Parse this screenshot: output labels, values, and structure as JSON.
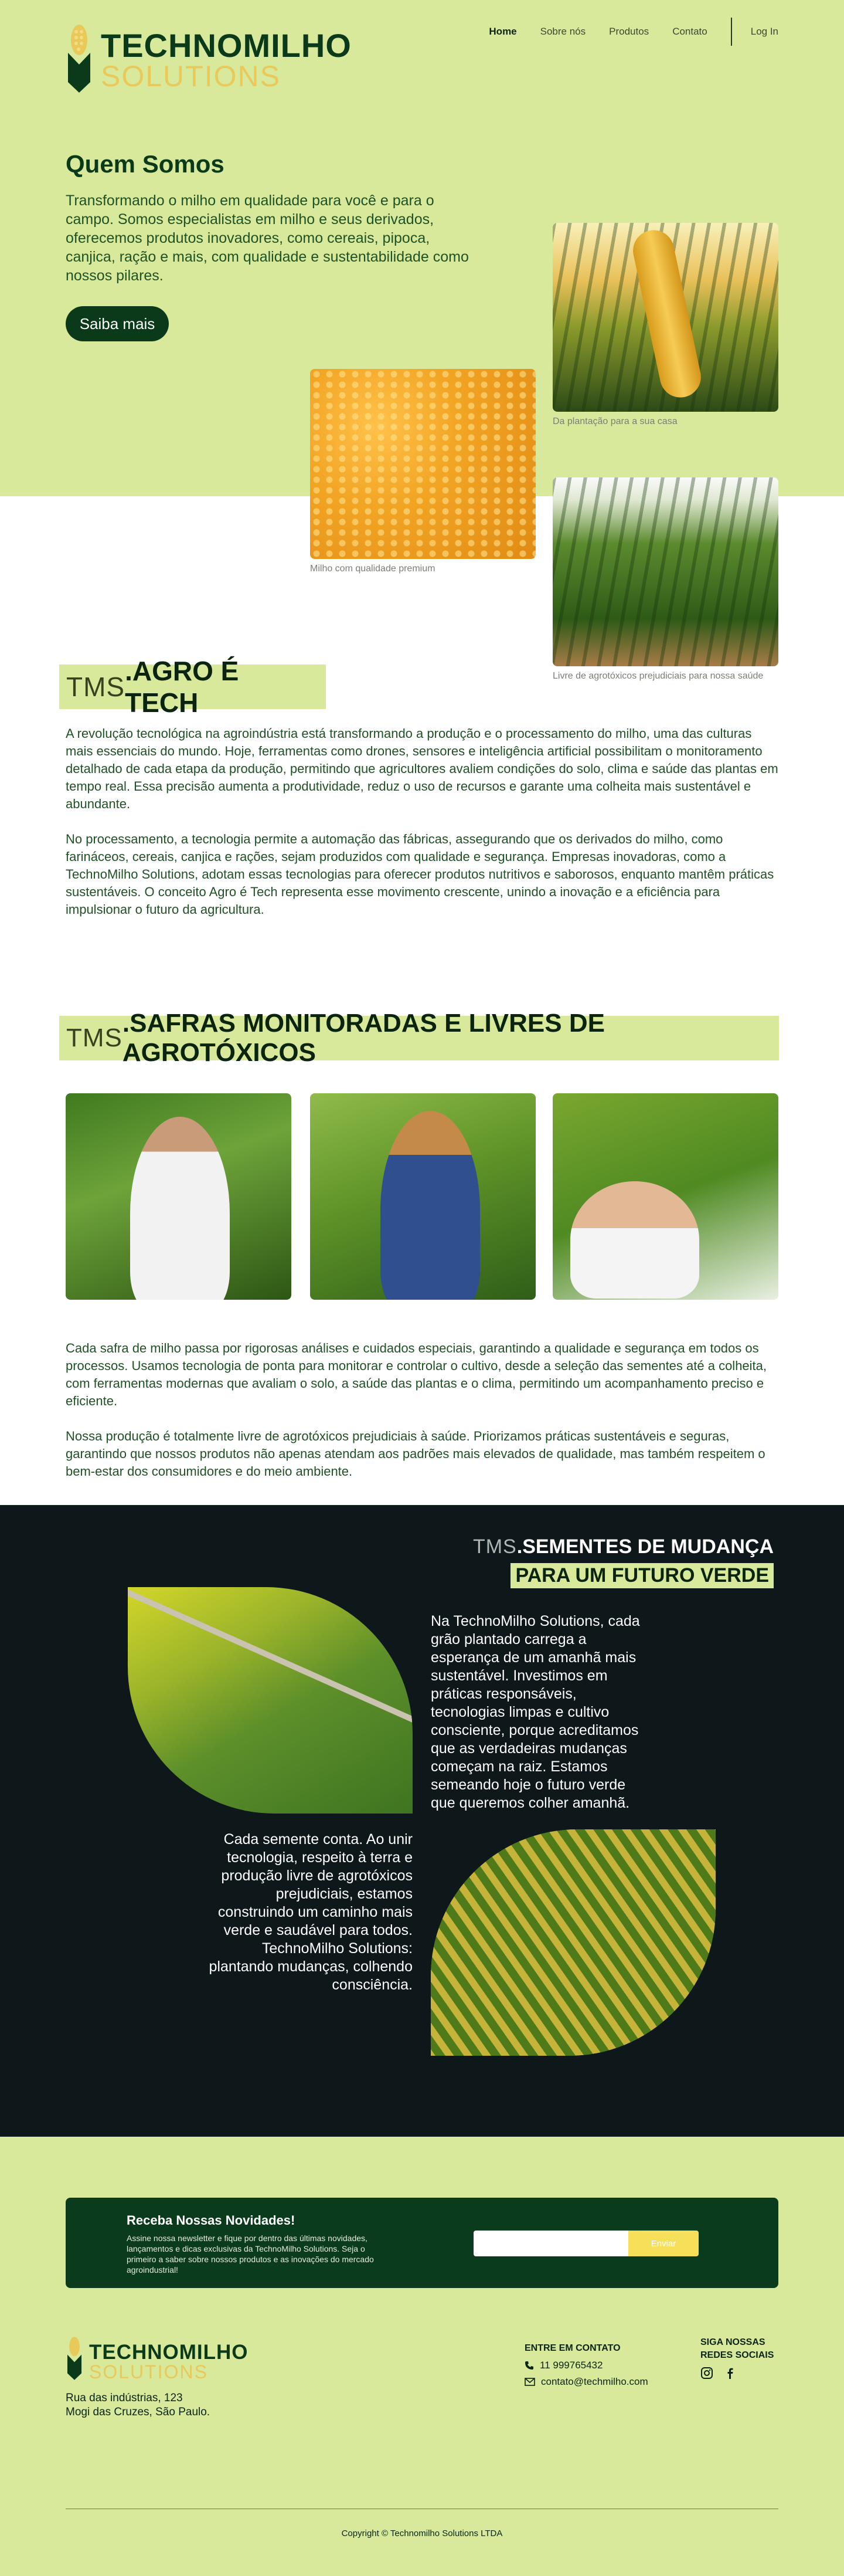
{
  "brand": {
    "name_line1": "TECHNOMILHO",
    "name_line2": "SOLUTIONS",
    "primary_color": "#0b3a1a",
    "accent_color": "#d8e99c",
    "gold_color": "#e8c95a"
  },
  "nav": {
    "items": [
      "Home",
      "Sobre nós",
      "Produtos",
      "Contato"
    ],
    "login": "Log In"
  },
  "hero": {
    "title": "Quem Somos",
    "description": "Transformando o milho em qualidade para você e para o campo. Somos especialistas em milho e seus derivados, oferecemos produtos inovadores, como cereais, pipoca, canjica, ração e mais,  com qualidade e sustentabilidade como nossos pilares.",
    "button": "Saiba mais",
    "captions": {
      "cob": "Da plantação para a sua casa",
      "kernels": "Milho com qualidade premium",
      "field": "Livre de agrotóxicos prejudiciais para nossa saúde"
    }
  },
  "agro": {
    "prefix": "TMS",
    "title": ".AGRO É TECH",
    "paragraphs": [
      "A revolução tecnológica na agroindústria está transformando a produção e o processamento do milho, uma das culturas mais essenciais do mundo. Hoje, ferramentas como drones, sensores e inteligência artificial possibilitam o monitoramento detalhado de cada etapa da produção, permitindo que agricultores avaliem condições do solo, clima e saúde das plantas em tempo real. Essa precisão aumenta a produtividade, reduz o uso de recursos e garante uma colheita mais sustentável e abundante.",
      "No processamento, a tecnologia permite a automação das fábricas, assegurando que os derivados do milho, como farináceos, cereais, canjica e rações, sejam produzidos com qualidade e segurança. Empresas inovadoras, como a TechnoMilho Solutions, adotam essas tecnologias para oferecer produtos nutritivos e saborosos, enquanto mantêm práticas sustentáveis. O conceito Agro é Tech representa esse movimento crescente, unindo a inovação e a eficiência para impulsionar o futuro da agricultura."
    ]
  },
  "safras": {
    "prefix": "TMS",
    "title": ".SAFRAS MONITORADAS E LIVRES DE AGROTÓXICOS",
    "paragraphs": [
      "Cada safra de milho passa por rigorosas análises e cuidados especiais, garantindo a qualidade e segurança em todos os processos. Usamos tecnologia de ponta para monitorar e controlar o cultivo, desde a seleção das sementes até a colheita, com ferramentas modernas que avaliam o solo, a saúde das plantas e o clima, permitindo um acompanhamento preciso e eficiente.",
      "Nossa produção é totalmente livre de agrotóxicos prejudiciais à saúde. Priorizamos práticas sustentáveis e seguras, garantindo que nossos produtos não apenas atendam aos padrões mais elevados de qualidade, mas também respeitem o bem-estar dos consumidores e do meio ambiente."
    ]
  },
  "sementes": {
    "prefix": "TMS",
    "title_line1": ".SEMENTES DE MUDANÇA",
    "title_line2": "PARA UM FUTURO VERDE",
    "text1": "Na TechnoMilho Solutions, cada grão plantado carrega a esperança de um amanhã mais sustentável. Investimos em práticas responsáveis, tecnologias limpas e cultivo consciente, porque acreditamos que as verdadeiras mudanças começam na raiz. Estamos semeando hoje o futuro verde que queremos colher amanhã.",
    "text2": "Cada semente conta. Ao unir tecnologia, respeito à terra e produção livre de agrotóxicos prejudiciais, estamos construindo um caminho mais verde e saudável para todos. TechnoMilho Solutions: plantando mudanças, colhendo consciência."
  },
  "newsletter": {
    "title": "Receba Nossas Novidades!",
    "description": "Assine nossa newsletter e fique por dentro das últimas novidades, lançamentos e dicas exclusivas da TechnoMilho Solutions. Seja o primeiro a saber sobre nossos produtos e as inovações do mercado agroindustrial!",
    "input_placeholder": "",
    "button": "Enviar"
  },
  "footer": {
    "address_line1": "Rua das indústrias, 123",
    "address_line2": "Mogi das Cruzes, São Paulo.",
    "contact_title": "ENTRE EM CONTATO",
    "phone": "11 999765432",
    "email": "contato@techmilho.com",
    "social_title": "SIGA NOSSAS REDES SOCIAIS",
    "social_icons": [
      "instagram-icon",
      "facebook-icon"
    ],
    "copyright": "Copyright © Technomilho Solutions LTDA"
  }
}
